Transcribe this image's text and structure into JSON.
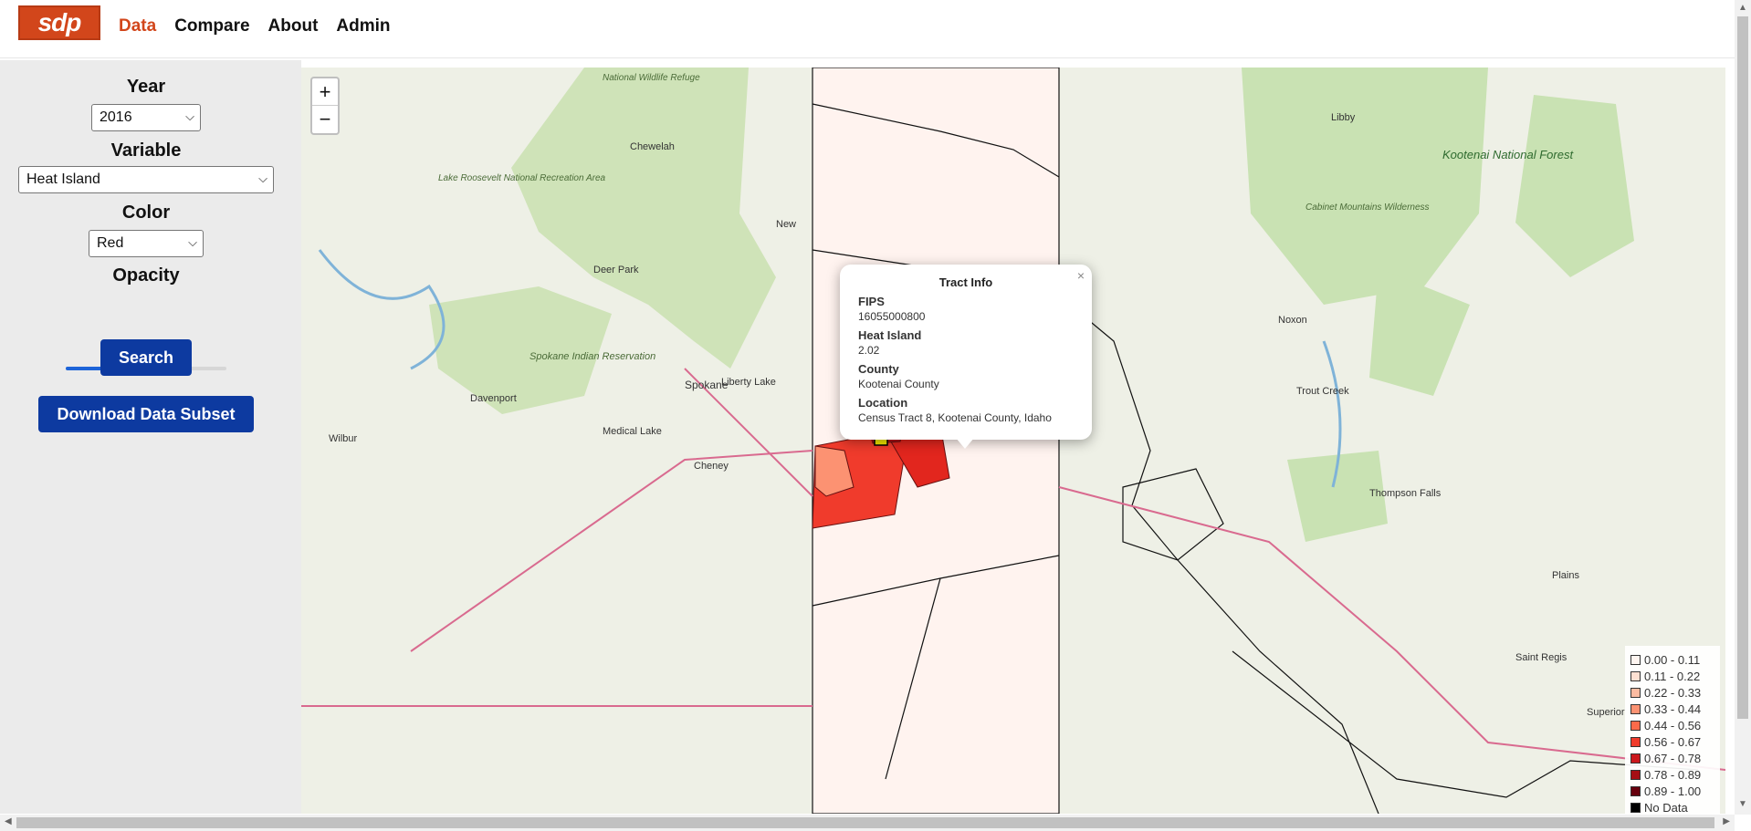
{
  "nav": {
    "logo_text": "sdp",
    "items": [
      "Data",
      "Compare",
      "About",
      "Admin"
    ],
    "active": "Data"
  },
  "sidebar": {
    "year_label": "Year",
    "year_value": "2016",
    "variable_label": "Variable",
    "variable_value": "Heat Island",
    "color_label": "Color",
    "color_value": "Red",
    "opacity_label": "Opacity",
    "opacity_value": 0.33,
    "search_button": "Search",
    "download_button": "Download Data Subset"
  },
  "map": {
    "zoom_in": "+",
    "zoom_out": "−",
    "place_labels": [
      "Spokane",
      "Liberty Lake",
      "Davenport",
      "Medical Lake",
      "Cheney",
      "Deer Park",
      "Chewelah",
      "Wilbur",
      "Spokane Indian Reservation",
      "Lake Roosevelt National Recreation Area",
      "National Wildlife Refuge",
      "Libby",
      "Kootenai National Forest",
      "Cabinet Mountains Wilderness",
      "Noxon",
      "Trout Creek",
      "Thompson Falls",
      "Plains",
      "Saint Regis",
      "Superior",
      "New"
    ]
  },
  "popup": {
    "title": "Tract Info",
    "fips_label": "FIPS",
    "fips_value": "16055000800",
    "variable_label": "Heat Island",
    "variable_value": "2.02",
    "county_label": "County",
    "county_value": "Kootenai County",
    "location_label": "Location",
    "location_value": "Census Tract 8, Kootenai County, Idaho",
    "close": "×"
  },
  "legend": [
    {
      "label": "0.00 - 0.11",
      "color": "#fff5f0"
    },
    {
      "label": "0.11 - 0.22",
      "color": "#fee0d2"
    },
    {
      "label": "0.22 - 0.33",
      "color": "#fcbba1"
    },
    {
      "label": "0.33 - 0.44",
      "color": "#fc9272"
    },
    {
      "label": "0.44 - 0.56",
      "color": "#fb6a4a"
    },
    {
      "label": "0.56 - 0.67",
      "color": "#ef3b2c"
    },
    {
      "label": "0.67 - 0.78",
      "color": "#cb181d"
    },
    {
      "label": "0.78 - 0.89",
      "color": "#a50f15"
    },
    {
      "label": "0.89 - 1.00",
      "color": "#67000d"
    },
    {
      "label": "No Data",
      "color": "#000000"
    }
  ]
}
